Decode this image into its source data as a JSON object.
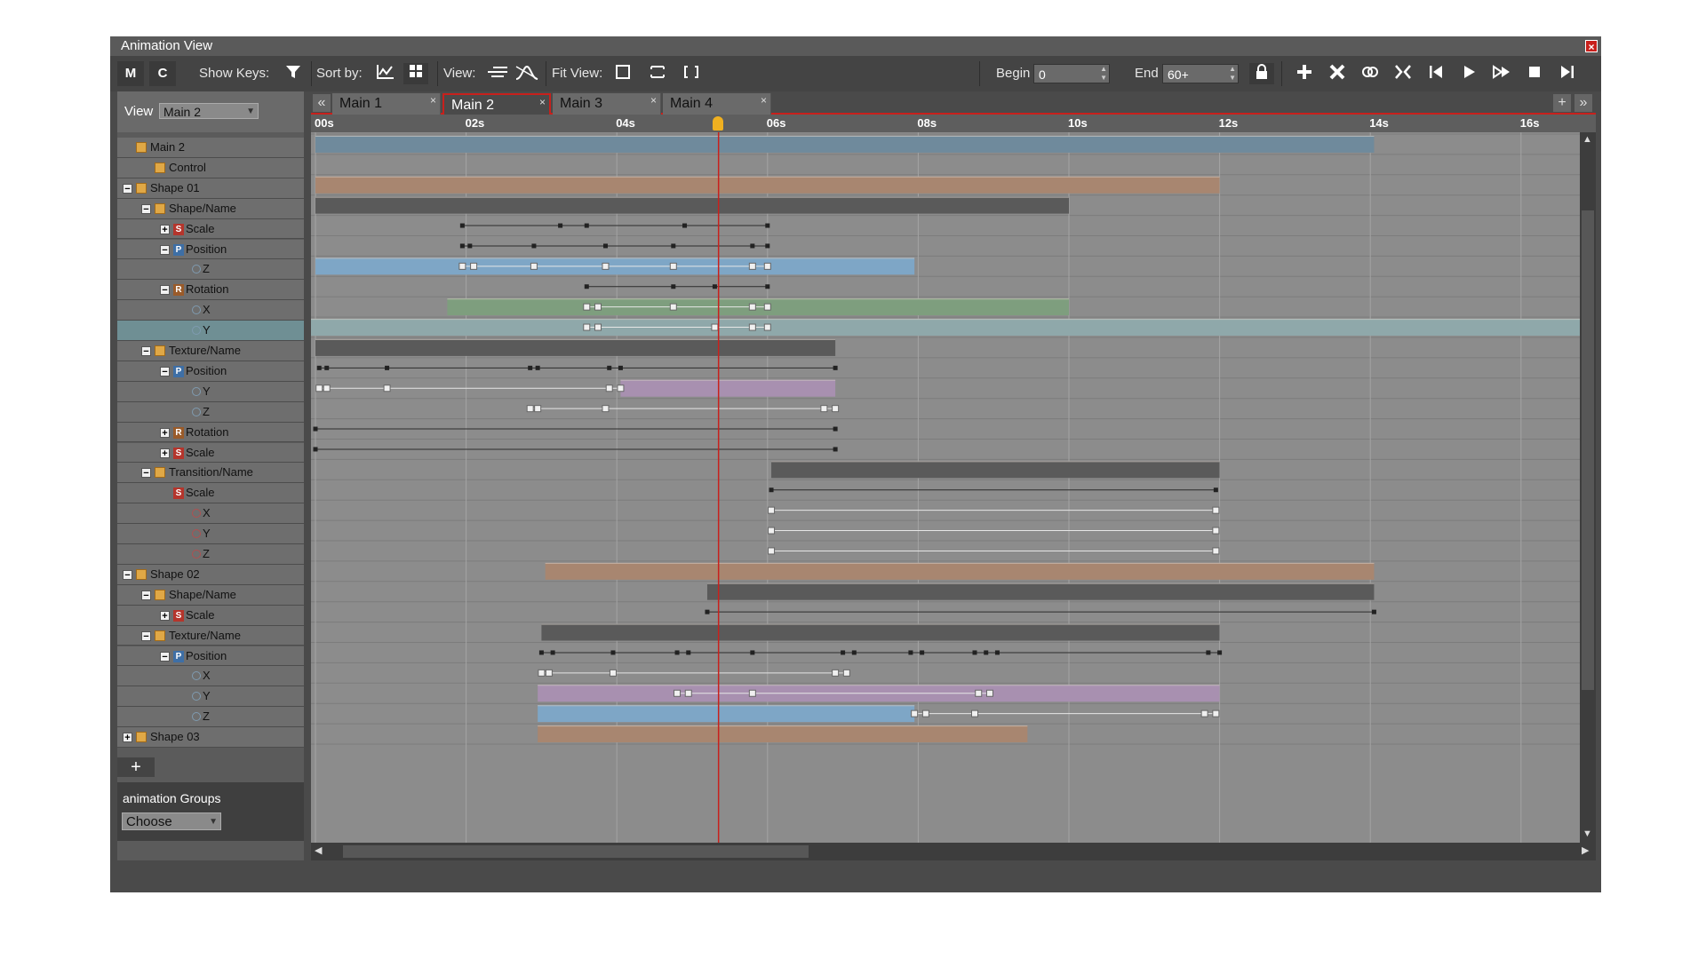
{
  "window": {
    "title": "Animation View",
    "close_label": "×"
  },
  "toolbar": {
    "m_label": "M",
    "c_label": "C",
    "show_keys_label": "Show Keys:",
    "sort_by_label": "Sort by:",
    "view_label": "View:",
    "fit_view_label": "Fit View:",
    "begin_label": "Begin",
    "begin_value": "0",
    "end_label": "End",
    "end_value": "60+",
    "icons": [
      "filter-icon",
      "sort-curve-icon",
      "sort-grid-icon",
      "view-lines-icon",
      "view-curves-icon",
      "fit-square-icon",
      "fit-height-icon",
      "fit-brackets-icon",
      "lock-icon",
      "add-key-icon",
      "delete-key-icon",
      "link-icon",
      "collapse-icon",
      "go-start-icon",
      "play-icon",
      "fast-forward-icon",
      "stop-icon",
      "go-end-icon"
    ]
  },
  "left": {
    "view_label": "View",
    "view_value": "Main 2",
    "add_label": "+",
    "groups_label": "animation Groups",
    "groups_value": "Choose"
  },
  "tabs": [
    {
      "label": "Main 1"
    },
    {
      "label": "Main 2"
    },
    {
      "label": "Main 3"
    },
    {
      "label": "Main 4"
    }
  ],
  "tab_close": "×",
  "ruler": {
    "ticks": [
      "00s",
      "02s",
      "04s",
      "06s",
      "08s",
      "10s",
      "12s",
      "14s",
      "16s"
    ]
  },
  "playhead_seconds": 5.35,
  "tree": [
    {
      "label": "Main 2",
      "indent": 0,
      "toggle": "",
      "icon": "box"
    },
    {
      "label": "Control",
      "indent": 1,
      "toggle": "",
      "icon": "box"
    },
    {
      "label": "Shape 01",
      "indent": 0,
      "toggle": "−",
      "icon": "box"
    },
    {
      "label": "Shape/Name",
      "indent": 1,
      "toggle": "−",
      "icon": "box"
    },
    {
      "label": "Scale",
      "indent": 2,
      "toggle": "+",
      "icon": "S"
    },
    {
      "label": "Position",
      "indent": 2,
      "toggle": "−",
      "icon": "P"
    },
    {
      "label": "Z",
      "indent": 3,
      "toggle": "",
      "icon": "circle"
    },
    {
      "label": "Rotation",
      "indent": 2,
      "toggle": "−",
      "icon": "R"
    },
    {
      "label": "X",
      "indent": 3,
      "toggle": "",
      "icon": "circle"
    },
    {
      "label": "Y",
      "indent": 3,
      "toggle": "",
      "icon": "circle",
      "selected": true
    },
    {
      "label": "Texture/Name",
      "indent": 1,
      "toggle": "−",
      "icon": "box"
    },
    {
      "label": "Position",
      "indent": 2,
      "toggle": "−",
      "icon": "P"
    },
    {
      "label": "Y",
      "indent": 3,
      "toggle": "",
      "icon": "circle"
    },
    {
      "label": "Z",
      "indent": 3,
      "toggle": "",
      "icon": "circle"
    },
    {
      "label": "Rotation",
      "indent": 2,
      "toggle": "+",
      "icon": "R"
    },
    {
      "label": "Scale",
      "indent": 2,
      "toggle": "+",
      "icon": "S"
    },
    {
      "label": "Transition/Name",
      "indent": 1,
      "toggle": "−",
      "icon": "box"
    },
    {
      "label": "Scale",
      "indent": 2,
      "toggle": "",
      "icon": "S"
    },
    {
      "label": "X",
      "indent": 3,
      "toggle": "",
      "icon": "circle-red"
    },
    {
      "label": "Y",
      "indent": 3,
      "toggle": "",
      "icon": "circle-red"
    },
    {
      "label": "Z",
      "indent": 3,
      "toggle": "",
      "icon": "circle-red"
    },
    {
      "label": "Shape 02",
      "indent": 0,
      "toggle": "−",
      "icon": "box"
    },
    {
      "label": "Shape/Name",
      "indent": 1,
      "toggle": "−",
      "icon": "box"
    },
    {
      "label": "Scale",
      "indent": 2,
      "toggle": "+",
      "icon": "S"
    },
    {
      "label": "Texture/Name",
      "indent": 1,
      "toggle": "−",
      "icon": "box"
    },
    {
      "label": "Position",
      "indent": 2,
      "toggle": "−",
      "icon": "P"
    },
    {
      "label": "X",
      "indent": 3,
      "toggle": "",
      "icon": "circle"
    },
    {
      "label": "Y",
      "indent": 3,
      "toggle": "",
      "icon": "circle"
    },
    {
      "label": "Z",
      "indent": 3,
      "toggle": "",
      "icon": "circle"
    },
    {
      "label": "Shape 03",
      "indent": 0,
      "toggle": "+",
      "icon": "box"
    }
  ],
  "tracks": [
    {
      "row": 0,
      "bar": {
        "start": 0,
        "end": 14.05,
        "color": "#6f8a9c"
      }
    },
    {
      "row": 2,
      "bar": {
        "start": 0,
        "end": 12,
        "color": "#a88670"
      }
    },
    {
      "row": 3,
      "bar": {
        "start": 0,
        "end": 10,
        "color": "#5a5a5a"
      }
    },
    {
      "row": 4,
      "keys": [
        1.95,
        3.25,
        3.6,
        4.9,
        6.0
      ],
      "line": true
    },
    {
      "row": 5,
      "keys": [
        1.95,
        2.05,
        2.9,
        3.85,
        4.75,
        5.8,
        6.0
      ],
      "line": true
    },
    {
      "row": 6,
      "bar": {
        "start": 0,
        "end": 7.95,
        "color": "#7ea6c6"
      },
      "hkeys": [
        1.95,
        2.1,
        2.9,
        3.85,
        4.75,
        5.8,
        6.0
      ],
      "line": true,
      "light": true
    },
    {
      "row": 7,
      "keys": [
        3.6,
        4.75,
        5.3,
        6.0
      ],
      "line": true
    },
    {
      "row": 8,
      "bar": {
        "start": 1.75,
        "end": 10,
        "color": "#7e9e7e"
      },
      "hkeys": [
        3.6,
        3.75,
        4.75,
        5.8,
        6.0
      ],
      "line": true,
      "light": true
    },
    {
      "row": 9,
      "bar": {
        "start": -0.15,
        "end": 16.85,
        "color": "#8fa8aa"
      },
      "hkeys": [
        3.6,
        3.75,
        5.3,
        5.8,
        6.0
      ],
      "line": true,
      "light": true
    },
    {
      "row": 10,
      "bar": {
        "start": 0,
        "end": 6.9,
        "color": "#5a5a5a"
      }
    },
    {
      "row": 11,
      "keys": [
        0.05,
        0.15,
        0.95,
        2.85,
        2.95,
        3.9,
        4.05,
        6.9
      ],
      "line": true
    },
    {
      "row": 12,
      "bar": {
        "start": 4.05,
        "end": 6.9,
        "color": "#a890b0"
      },
      "hkeys": [
        0.05,
        0.15,
        0.95,
        3.9,
        4.05
      ],
      "line": true,
      "light": true
    },
    {
      "row": 13,
      "hkeys": [
        2.85,
        2.95,
        3.85,
        6.75,
        6.9
      ],
      "line": true,
      "light": true
    },
    {
      "row": 14,
      "keys": [
        0.0,
        6.9
      ],
      "line": true
    },
    {
      "row": 15,
      "keys": [
        0.0,
        6.9
      ],
      "line": true
    },
    {
      "row": 16,
      "bar": {
        "start": 6.05,
        "end": 12,
        "color": "#5a5a5a"
      }
    },
    {
      "row": 17,
      "keys": [
        6.05,
        11.95
      ],
      "line": true
    },
    {
      "row": 18,
      "hkeys": [
        6.05,
        11.95
      ],
      "line": true,
      "light": true
    },
    {
      "row": 19,
      "hkeys": [
        6.05,
        11.95
      ],
      "line": true,
      "light": true
    },
    {
      "row": 20,
      "hkeys": [
        6.05,
        11.95
      ],
      "line": true,
      "light": true
    },
    {
      "row": 21,
      "bar": {
        "start": 3.05,
        "end": 14.05,
        "color": "#a88670"
      }
    },
    {
      "row": 22,
      "bar": {
        "start": 5.2,
        "end": 14.05,
        "color": "#5a5a5a"
      }
    },
    {
      "row": 23,
      "keys": [
        5.2,
        14.05
      ],
      "line": true
    },
    {
      "row": 24,
      "bar": {
        "start": 3.0,
        "end": 12,
        "color": "#5a5a5a"
      }
    },
    {
      "row": 25,
      "keys": [
        3.0,
        3.15,
        3.95,
        4.8,
        4.95,
        5.8,
        7.0,
        7.15,
        7.9,
        8.05,
        8.75,
        8.9,
        9.05,
        11.85,
        12.0
      ],
      "line": true
    },
    {
      "row": 26,
      "hkeys": [
        3.0,
        3.1,
        3.95,
        6.9,
        7.05
      ],
      "line": true,
      "light": true
    },
    {
      "row": 27,
      "bar": {
        "start": 2.95,
        "end": 12,
        "color": "#a890b0"
      },
      "hkeys": [
        4.8,
        4.95,
        5.8,
        8.8,
        8.95
      ],
      "line": true,
      "light": true
    },
    {
      "row": 28,
      "bar": {
        "start": 2.95,
        "end": 7.95,
        "color": "#7ea6c6"
      },
      "hkeys": [
        7.95,
        8.1,
        8.75,
        11.8,
        11.95
      ],
      "line": true,
      "light": true
    },
    {
      "row": 29,
      "bar": {
        "start": 2.95,
        "end": 9.45,
        "color": "#a88670"
      }
    }
  ]
}
